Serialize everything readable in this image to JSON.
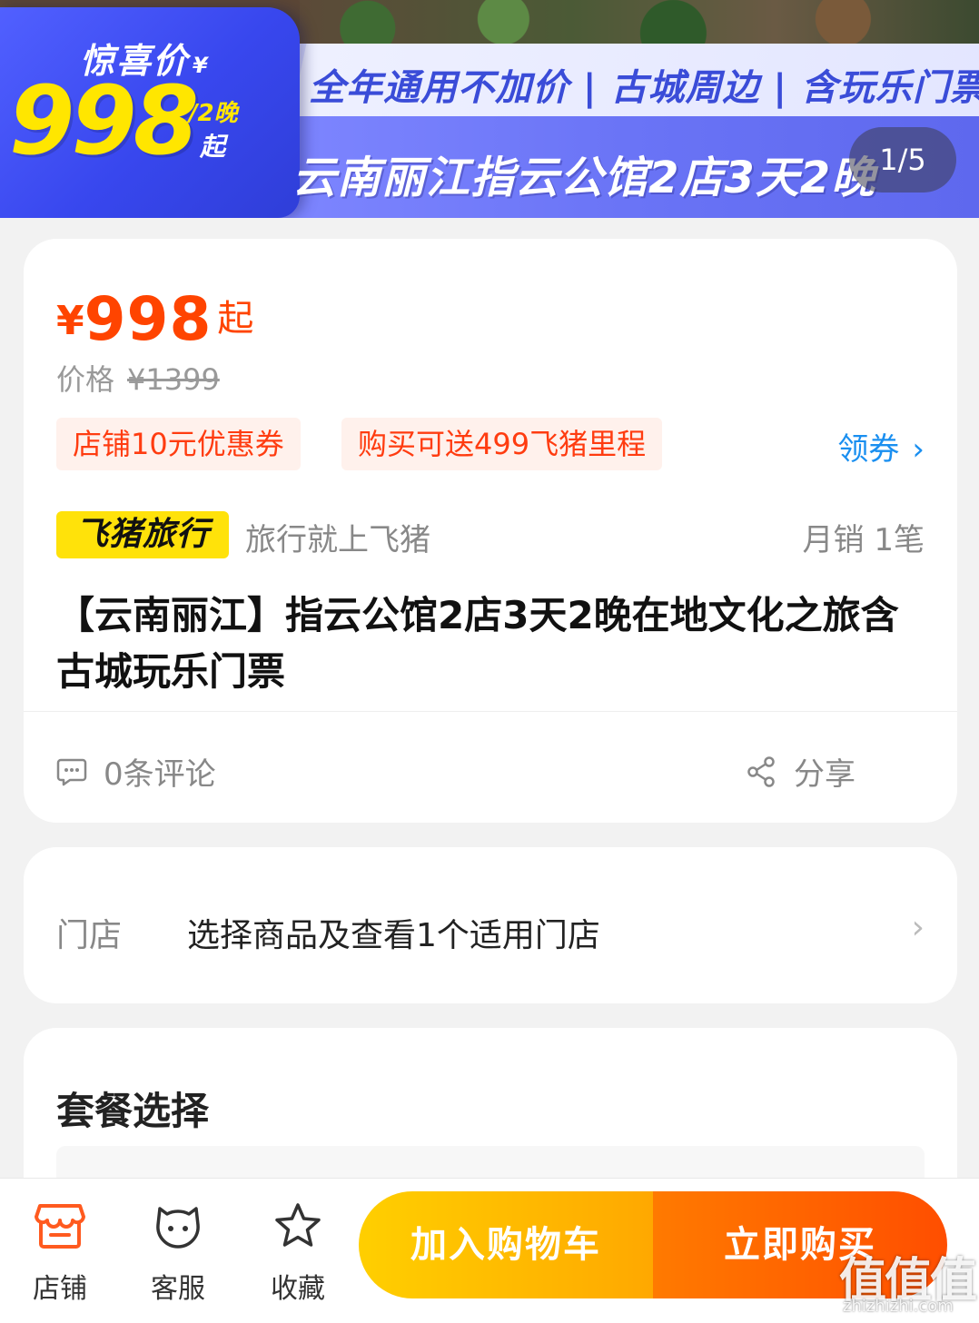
{
  "banner": {
    "promo_label": "惊喜价",
    "promo_yen": "¥",
    "promo_price": "998",
    "promo_unit": "/2晚",
    "promo_qi": "起",
    "tagline": "全年通用不加价 | 古城周边 | 含玩乐门票",
    "headline": "云南丽江指云公馆2店3天2晚",
    "pager": "1/5"
  },
  "price": {
    "currency": "¥",
    "value": "998",
    "suffix": "起",
    "original_label": "价格",
    "original_value": "¥1399"
  },
  "coupons": {
    "items": [
      "店铺10元优惠券",
      "购买可送499飞猪里程"
    ],
    "get_label": "领券",
    "get_chevron": "›"
  },
  "brand": {
    "badge": "飞猪旅行",
    "slogan": "旅行就上飞猪",
    "monthly_sales": "月销 1笔"
  },
  "product": {
    "title": "【云南丽江】指云公馆2店3天2晚在地文化之旅含古城玩乐门票"
  },
  "social": {
    "reviews": "0条评论",
    "share": "分享"
  },
  "store": {
    "label": "门店",
    "value": "选择商品及查看1个适用门店",
    "chevron": "›"
  },
  "package": {
    "title": "套餐选择"
  },
  "bottom_nav": {
    "shop": "店铺",
    "service": "客服",
    "favorite": "收藏",
    "add_to_cart": "加入购物车",
    "buy_now": "立即购买"
  },
  "watermark": {
    "main": "值值值",
    "sub": "zhizhizhi.com"
  },
  "colors": {
    "accent_price": "#ff4400",
    "coupon_text": "#ff3c10",
    "link": "#1a8ff0",
    "brand_yellow": "#ffe20a",
    "cart_button": "#ffb800",
    "buy_button": "#ff5a00"
  },
  "icons": {
    "review": "chat-bubble-icon",
    "share": "share-icon",
    "shop": "store-icon",
    "service": "customer-service-icon",
    "favorite": "star-icon"
  }
}
